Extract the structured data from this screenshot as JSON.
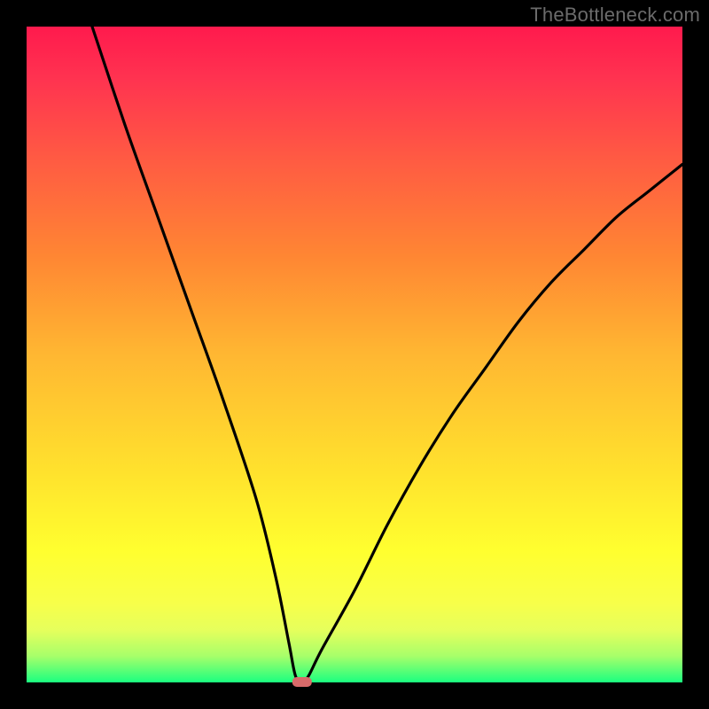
{
  "watermark": "TheBottleneck.com",
  "chart_data": {
    "type": "line",
    "title": "",
    "xlabel": "",
    "ylabel": "",
    "xlim": [
      0,
      100
    ],
    "ylim": [
      0,
      100
    ],
    "x": [
      10,
      15,
      20,
      25,
      30,
      35,
      38,
      40,
      41,
      42,
      43,
      45,
      50,
      55,
      60,
      65,
      70,
      75,
      80,
      85,
      90,
      95,
      100
    ],
    "values": [
      100,
      85,
      71,
      57,
      43,
      28,
      16,
      6,
      1,
      0,
      1,
      5,
      14,
      24,
      33,
      41,
      48,
      55,
      61,
      66,
      71,
      75,
      79
    ],
    "minimum_marker": {
      "x": 42,
      "y": 0
    },
    "background_gradient_colors": [
      "#ff1a4d",
      "#ffb732",
      "#ffff2f",
      "#1bff80"
    ]
  }
}
